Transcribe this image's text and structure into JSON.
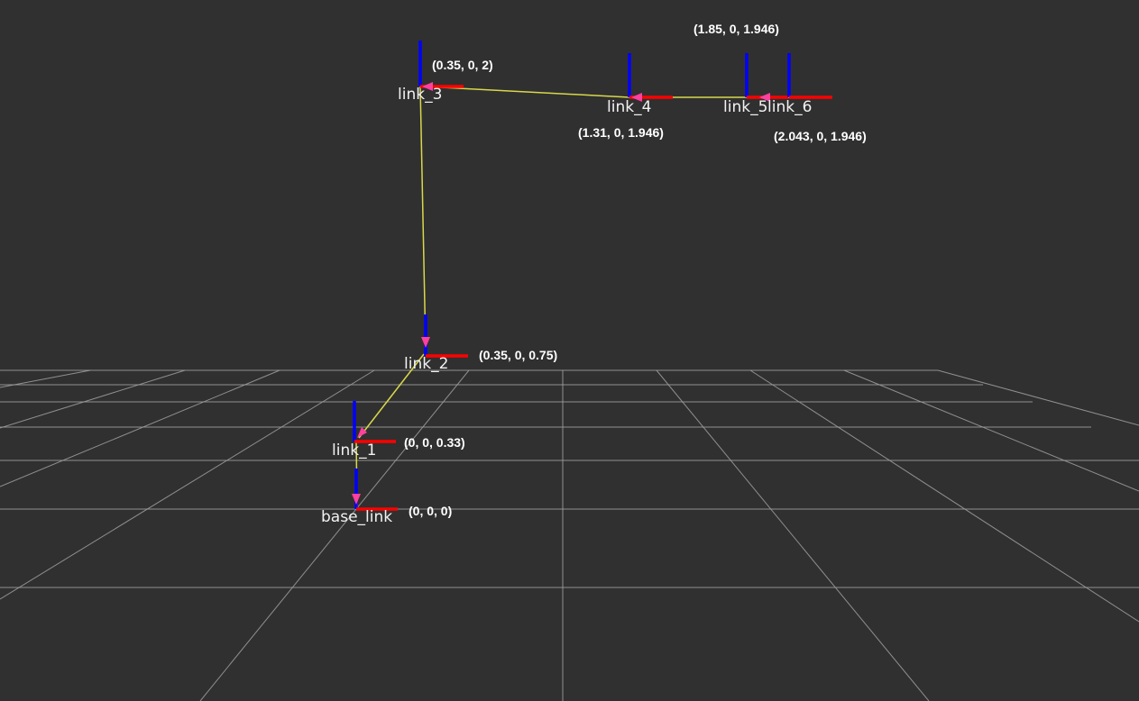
{
  "view": {
    "background_color": "#303030",
    "grid_color": "#a0a0a0",
    "tf_link_color": "#d8d84a",
    "x_axis_color": "#ff0000",
    "z_axis_color": "#0000ff",
    "arrow_color": "#ff40a0"
  },
  "frames": [
    {
      "id": "base_link",
      "name": "base_link",
      "coords": "(0, 0, 0)"
    },
    {
      "id": "link_1",
      "name": "link_1",
      "coords": "(0, 0, 0.33)"
    },
    {
      "id": "link_2",
      "name": "link_2",
      "coords": "(0.35, 0, 0.75)"
    },
    {
      "id": "link_3",
      "name": "link_3",
      "coords": "(0.35, 0, 2)"
    },
    {
      "id": "link_4",
      "name": "link_4",
      "coords": "(1.31, 0, 1.946)"
    },
    {
      "id": "link_5",
      "name": "link_5",
      "coords": "(1.85, 0, 1.946)"
    },
    {
      "id": "link_6",
      "name": "link_6",
      "coords": "(2.043, 0, 1.946)"
    }
  ]
}
